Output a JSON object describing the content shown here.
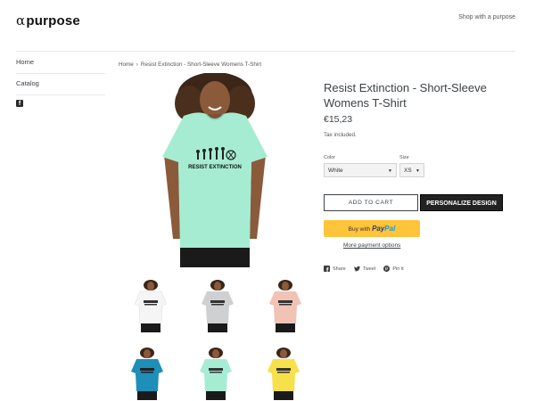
{
  "header": {
    "logo_symbol": "α",
    "logo_text": "purpose",
    "link": "Shop with a purpose"
  },
  "sidebar": {
    "items": [
      {
        "label": "Home"
      },
      {
        "label": "Catalog"
      }
    ],
    "facebook_icon": "facebook-icon"
  },
  "breadcrumb": {
    "home": "Home",
    "separator": "›",
    "current": "Resist Extinction - Short-Sleeve Womens T-Shirt"
  },
  "main_image": {
    "shirt_color": "#a6ecd3",
    "shirt_text": "RESIST EXTINCTION"
  },
  "thumbnails": [
    {
      "color": "#f5f5f5"
    },
    {
      "color": "#cfd0d1"
    },
    {
      "color": "#f0c3b5"
    },
    {
      "color": "#1e8fb8"
    },
    {
      "color": "#a6ecd3"
    },
    {
      "color": "#f6e14a"
    }
  ],
  "product": {
    "title": "Resist Extinction - Short-Sleeve Womens T-Shirt",
    "price": "€15,23",
    "tax_note": "Tax included."
  },
  "options": {
    "color_label": "Color",
    "color_value": "White",
    "size_label": "Size",
    "size_value": "XS"
  },
  "buttons": {
    "add_to_cart": "ADD TO CART",
    "personalize": "PERSONALIZE DESIGN",
    "paypal_prefix": "Buy with",
    "paypal_brand_1": "Pay",
    "paypal_brand_2": "Pal",
    "more_payment": "More payment options"
  },
  "share": {
    "facebook": "Share",
    "twitter": "Tweet",
    "pinterest": "Pin it"
  }
}
